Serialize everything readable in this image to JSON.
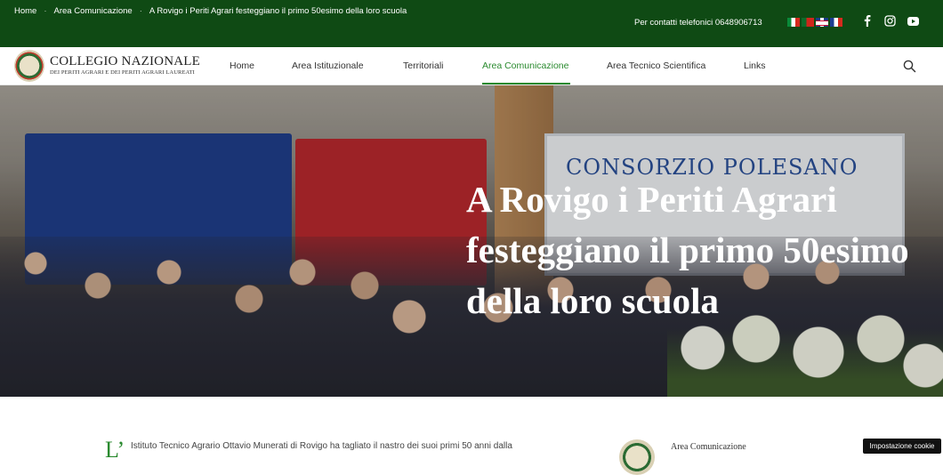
{
  "topbar": {
    "breadcrumbs": [
      "Home",
      "Area Comunicazione",
      "A Rovigo i Periti Agrari festeggiano il primo 50esimo della loro scuola"
    ],
    "contact_label": "Per contatti telefonici",
    "contact_phone": "0648906713",
    "flags": [
      "italian-flag",
      "portuguese-flag",
      "english-flag",
      "french-flag"
    ],
    "social": [
      "facebook-icon",
      "instagram-icon",
      "youtube-icon"
    ]
  },
  "brand": {
    "title": "COLLEGIO NAZIONALE",
    "subtitle": "DEI PERITI AGRARI E DEI PERITI AGRARI LAUREATI"
  },
  "nav": {
    "items": [
      {
        "label": "Home"
      },
      {
        "label": "Area Istituzionale"
      },
      {
        "label": "Territoriali"
      },
      {
        "label": "Area Comunicazione",
        "active": true
      },
      {
        "label": "Area Tecnico Scientifica"
      },
      {
        "label": "Links"
      }
    ],
    "accent": "#2a8a2f"
  },
  "hero": {
    "title": "A Rovigo i Periti Agrari festeggiano il primo 50esimo della loro scuola",
    "banner_text": "CONSORZIO POLESANO"
  },
  "article": {
    "dropcap": "L’",
    "lead": "Istituto Tecnico Agrario Ottavio Munerati di Rovigo ha tagliato il nastro dei suoi primi 50 anni dalla"
  },
  "sidebar": {
    "category": "Area Comunicazione"
  },
  "cookie": {
    "label": "Impostazione cookie"
  },
  "colors": {
    "topbar_bg": "#0f4a14",
    "accent_green": "#2a8a2f"
  }
}
